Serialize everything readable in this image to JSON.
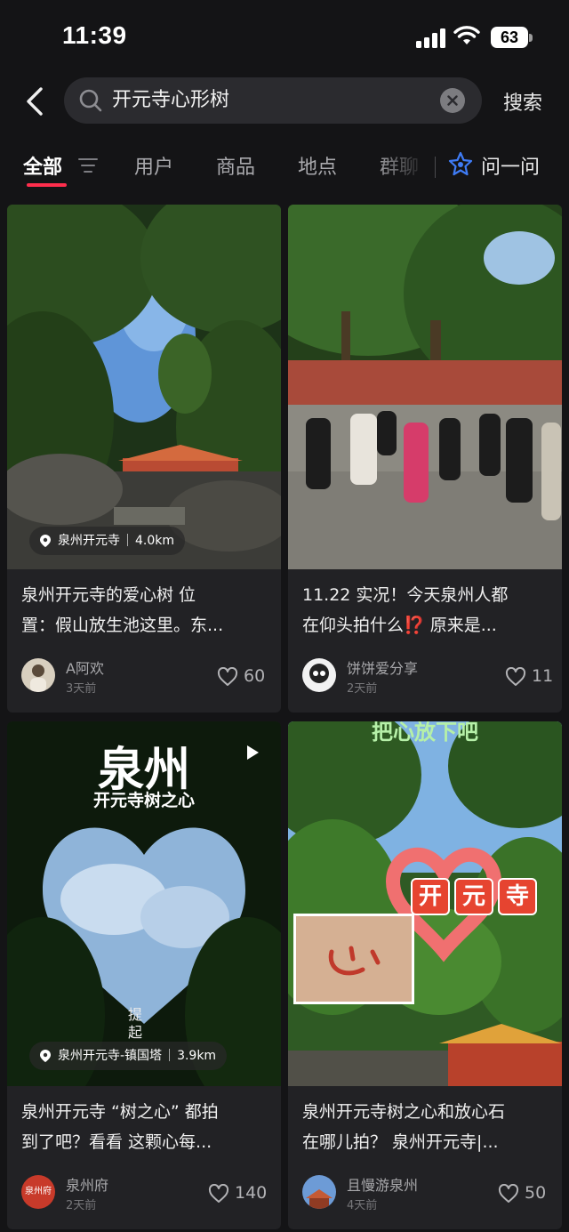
{
  "status_bar": {
    "time": "11:39",
    "battery": "63"
  },
  "search": {
    "query": "开元寺心形树",
    "submit_label": "搜索"
  },
  "tabs": {
    "items": [
      {
        "label": "全部",
        "active": true
      },
      {
        "label": "用户"
      },
      {
        "label": "商品"
      },
      {
        "label": "地点"
      },
      {
        "label": "群聊"
      }
    ],
    "ask_label": "问一问"
  },
  "colors": {
    "accent": "#ff2e4d",
    "background": "#141416",
    "card": "#222225",
    "ask_icon": "#3f7cf6"
  },
  "posts": [
    {
      "location": "泉州开元寺",
      "distance": "4.0km",
      "title_line1": "泉州开元寺的爱心树 位",
      "title_line2": "置：假山放生池这里。东...",
      "author": "A阿欢",
      "time": "3天前",
      "likes": "60"
    },
    {
      "title_line1": "11.22 实况！今天泉州人都",
      "title_line2": "在仰头拍什么⁉️ 原来是...",
      "author": "饼饼爱分享",
      "time": "2天前",
      "likes": "11"
    },
    {
      "location": "泉州开元寺-镇国塔",
      "distance": "3.9km",
      "cover_title": "泉州",
      "cover_subtitle": "开元寺树之心",
      "cover_vertical": "提起",
      "title_line1": "泉州开元寺 “树之心” 都拍",
      "title_line2": "到了吧？看看 这颗心每...",
      "author": "泉州府",
      "avatar_text": "泉州府",
      "time": "2天前",
      "likes": "140"
    },
    {
      "cover_top": "把心放下吧",
      "cover_tag": [
        "开",
        "元",
        "寺"
      ],
      "title_line1": "泉州开元寺树之心和放心石",
      "title_line2": "在哪儿拍？ 泉州开元寺|...",
      "author": "且慢游泉州",
      "time": "4天前",
      "likes": "50"
    }
  ]
}
